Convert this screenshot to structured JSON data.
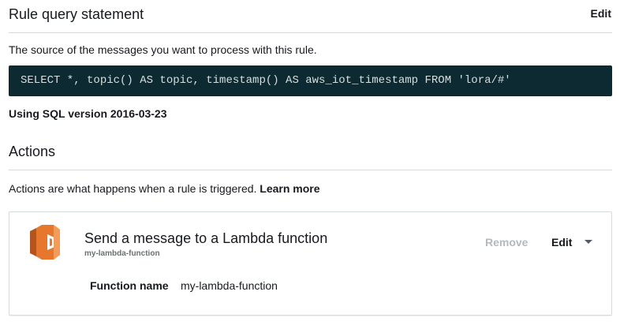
{
  "rule_query": {
    "title": "Rule query statement",
    "edit_label": "Edit",
    "description": "The source of the messages you want to process with this rule.",
    "sql": "SELECT *, topic() AS topic, timestamp() AS aws_iot_timestamp FROM 'lora/#'",
    "sql_version": "Using SQL version 2016-03-23"
  },
  "actions": {
    "title": "Actions",
    "description": "Actions are what happens when a rule is triggered.",
    "learn_more": "Learn more",
    "items": [
      {
        "icon": "lambda-icon",
        "title": "Send a message to a Lambda function",
        "subtitle": "my-lambda-function",
        "remove_label": "Remove",
        "edit_label": "Edit",
        "field_label": "Function name",
        "field_value": "my-lambda-function"
      }
    ]
  },
  "colors": {
    "code_background": "#0d2a33",
    "lambda_orange": "#e8772e",
    "lambda_orange_dark": "#b5541c",
    "disabled_text": "#b4b9bd",
    "divider": "#d5dbdb"
  }
}
